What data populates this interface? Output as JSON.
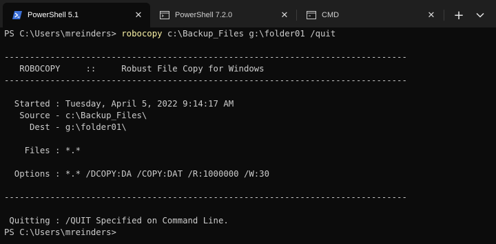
{
  "tabs": [
    {
      "label": "PowerShell 5.1",
      "icon": "powershell-icon",
      "active": true
    },
    {
      "label": "PowerShell 7.2.0",
      "icon": "terminal-window-icon",
      "active": false
    },
    {
      "label": "CMD",
      "icon": "cmd-icon",
      "active": false
    }
  ],
  "toolbar": {
    "new_tab_glyph": "+",
    "close_glyph": "✕"
  },
  "terminal": {
    "prompt": "PS C:\\Users\\mreinders>",
    "command": "robocopy",
    "command_args": "c:\\Backup_Files g:\\folder01 /quit",
    "rule": "-------------------------------------------------------------------------------",
    "header": "   ROBOCOPY     ::     Robust File Copy for Windows",
    "started": "  Started : Tuesday, April 5, 2022 9:14:17 AM",
    "source": "   Source - c:\\Backup_Files\\",
    "dest": "     Dest - g:\\folder01\\",
    "files": "    Files : *.*",
    "options": "  Options : *.* /DCOPY:DA /COPY:DAT /R:1000000 /W:30",
    "quitting": " Quitting : /QUIT Specified on Command Line.",
    "final_prompt": "PS C:\\Users\\mreinders>"
  },
  "colors": {
    "background": "#0c0c0c",
    "text": "#cccccc",
    "command": "#f9f1a5",
    "tabbar": "#1f1f1f"
  }
}
